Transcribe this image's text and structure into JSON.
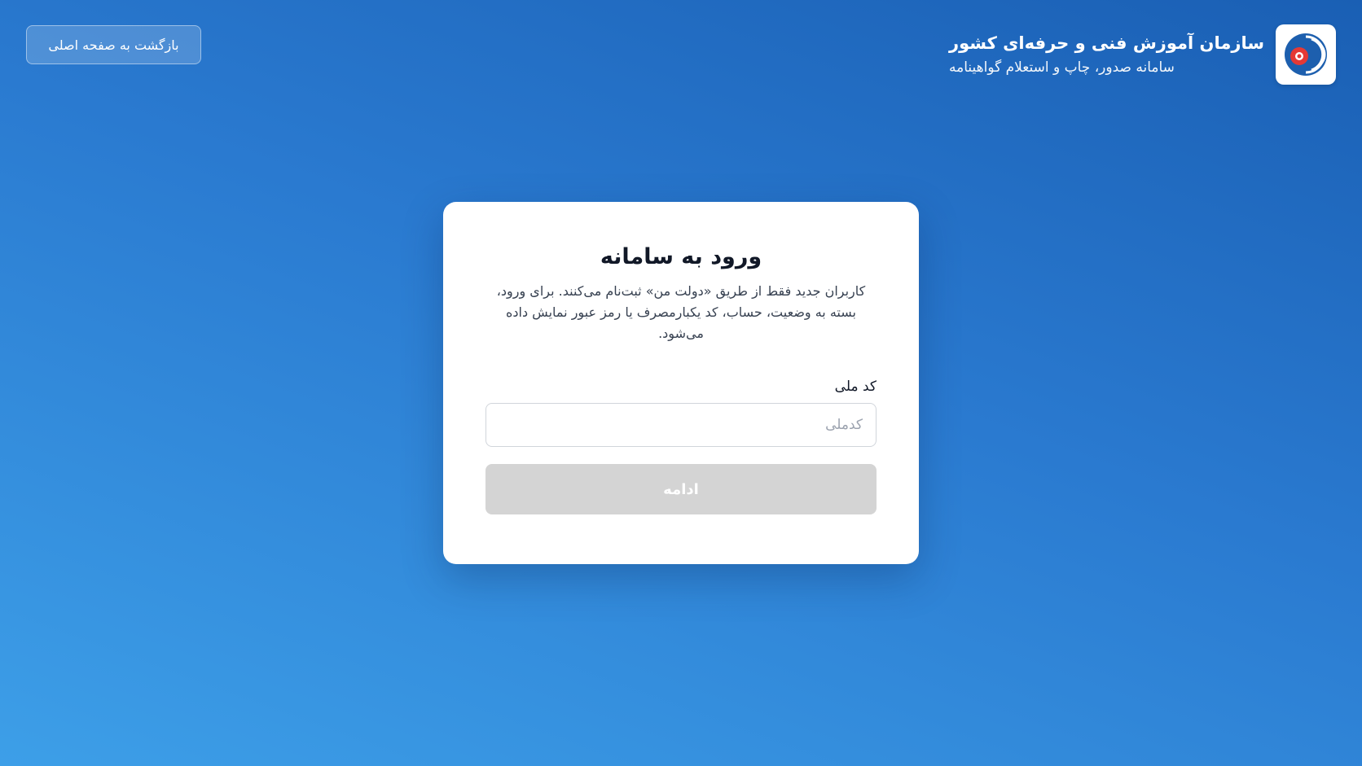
{
  "header": {
    "org_title": "سازمان آموزش فنی و حرفه‌ای کشور",
    "system_subtitle": "سامانه صدور، چاپ و استعلام گواهینامه",
    "back_button_label": "بازگشت به صفحه اصلی",
    "logo_icon": "tvto-logo-icon"
  },
  "login": {
    "title": "ورود به سامانه",
    "description": "کاربران جدید فقط از طریق «دولت من» ثبت‌نام می‌کنند. برای ورود، بسته به وضعیت، حساب، کد یکبارمصرف یا رمز عبور نمایش داده می‌شود.",
    "national_code_label": "کد ملی",
    "national_code_placeholder": "کدملی",
    "national_code_value": "",
    "continue_button_label": "ادامه"
  },
  "colors": {
    "background_top": "#1a5fb4",
    "background_bottom": "#3d9fe8",
    "button_disabled": "#d4d4d4",
    "logo_blue": "#1d5fae",
    "logo_red": "#e53935"
  }
}
